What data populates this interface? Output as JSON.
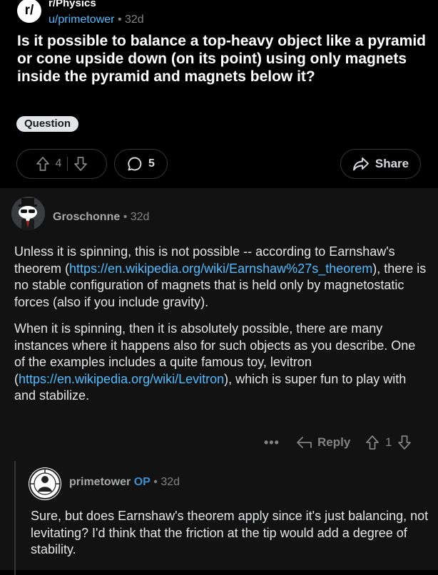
{
  "post": {
    "subreddit_logo": "r/",
    "subreddit": "r/Physics",
    "author": "u/primetower",
    "separator": "•",
    "age": "32d",
    "title": "Is it possible to balance a  top-heavy object like a pyramid or cone upside down (on its point) using only magnets inside the pyramid and magnets below it?",
    "flair": "Question",
    "score": "4",
    "comment_count": "5",
    "share_label": "Share",
    "icons": [
      "arrow-up-icon",
      "arrow-down-icon",
      "comment-bubble-icon",
      "share-arrow-icon"
    ]
  },
  "comment1": {
    "author": "Groschonne",
    "separator": "•",
    "age": "32d",
    "p1_a": "Unless it is spinning, this is not possible -- according to Earnshaw's theorem (",
    "p1_link": "https://en.wikipedia.org/wiki/Earnshaw%27s_theorem",
    "p1_b": "), there is no stable configuration of magnets that is held only by magnetostatic forces (also if you include gravity).",
    "p2_a": "When it is spinning, then it is absolutely possible, there are many instances where it happens also for such objects as you describe. One of the examples includes a quite famous toy, levitron (",
    "p2_link": "https://en.wikipedia.org/wiki/Levitron",
    "p2_b": "), which is super fun to play with and stabilize.",
    "more": "•••",
    "reply_label": "Reply",
    "score": "1"
  },
  "comment2": {
    "author": "primetower",
    "op_badge": "OP",
    "separator": "•",
    "age": "32d",
    "body": "Sure, but does Earnshaw's theorem apply since it's just balancing, not levitating? I'd think that the friction at the tip would add a degree of stability."
  },
  "colors": {
    "background": "#000000",
    "comment_background": "#121212",
    "link": "#4fbcff",
    "op_badge": "#3d8fd1",
    "muted": "#818384"
  }
}
